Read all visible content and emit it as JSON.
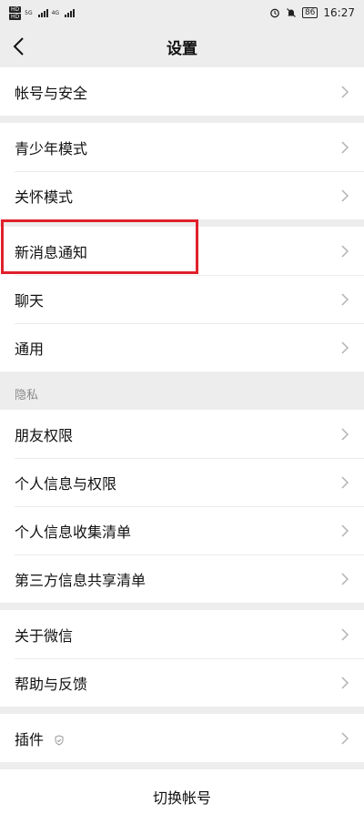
{
  "status_bar": {
    "hd1": "HD",
    "hd2": "HD",
    "net1": "5G",
    "net2": "4G",
    "battery": "86",
    "time": "16:27"
  },
  "header": {
    "title": "设置"
  },
  "groups": {
    "account": {
      "items": [
        "帐号与安全"
      ]
    },
    "modes": {
      "items": [
        "青少年模式",
        "关怀模式"
      ]
    },
    "general": {
      "items": [
        "新消息通知",
        "聊天",
        "通用"
      ]
    },
    "privacy": {
      "label": "隐私",
      "items": [
        "朋友权限",
        "个人信息与权限",
        "个人信息收集清单",
        "第三方信息共享清单"
      ]
    },
    "about": {
      "items": [
        "关于微信",
        "帮助与反馈"
      ]
    },
    "plugins": {
      "items": [
        "插件"
      ]
    }
  },
  "footer": {
    "switch_account": "切换帐号"
  },
  "colors": {
    "highlight": "#e0202a",
    "background": "#ededed"
  }
}
